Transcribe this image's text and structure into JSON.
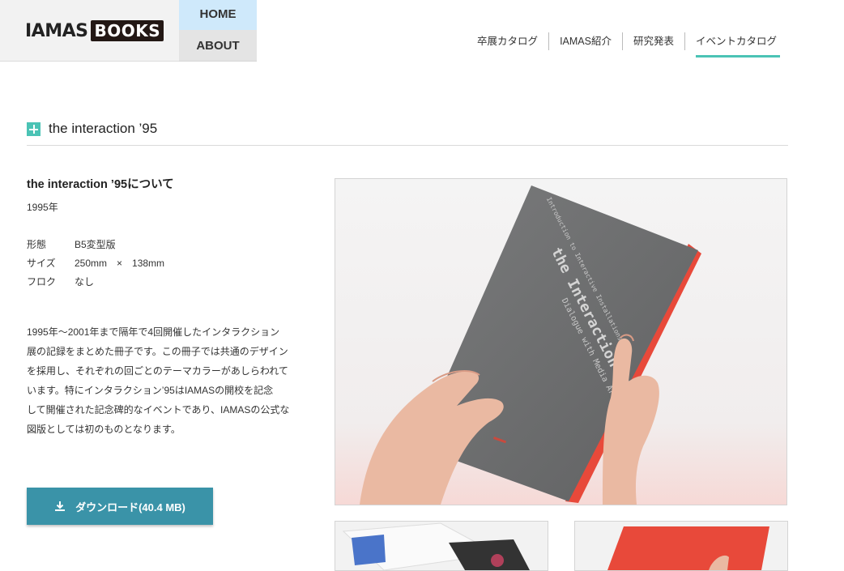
{
  "logo": {
    "part1": "IAMAS",
    "part2": "BOOKS"
  },
  "side_nav": {
    "home": "HOME",
    "about": "ABOUT"
  },
  "top_nav": [
    {
      "label": "卒展カタログ",
      "active": false
    },
    {
      "label": "IAMAS紹介",
      "active": false
    },
    {
      "label": "研究発表",
      "active": false
    },
    {
      "label": "イベントカタログ",
      "active": true
    }
  ],
  "section": {
    "title": "the interaction ’95"
  },
  "book": {
    "heading": "the interaction ’95について",
    "year": "1995年",
    "specs": [
      {
        "key": "形態",
        "value": "B5変型版"
      },
      {
        "key": "サイズ",
        "value": "250mm　×　138mm"
      },
      {
        "key": "フロク",
        "value": "なし"
      }
    ],
    "description_lines": [
      "1995年〜2001年まで隔年で4回開催したインタラクション",
      "展の記録をまとめた冊子です。この冊子では共通のデザイン",
      "を採用し、それぞれの回ごとのテーマカラーがあしらわれて",
      "います。特にインタラクション’95はIAMASの開校を記念",
      "して開催された記念碑的なイベントであり、IAMASの公式な",
      "図版としては初のものとなります。"
    ]
  },
  "download": {
    "label": "ダウンロード(40.4 MB)",
    "icon": "download-icon"
  },
  "photo": {
    "cover_text_1": "the Interaction ’95",
    "cover_text_2": "Introduction to Interactive Installations",
    "cover_text_3": "Dialogue with Media Art"
  },
  "colors": {
    "accent": "#4bc3b5",
    "button": "#3a93a8",
    "home_bg": "#cfe9fb",
    "book_gray": "#6f7071",
    "book_red": "#e8493a"
  }
}
